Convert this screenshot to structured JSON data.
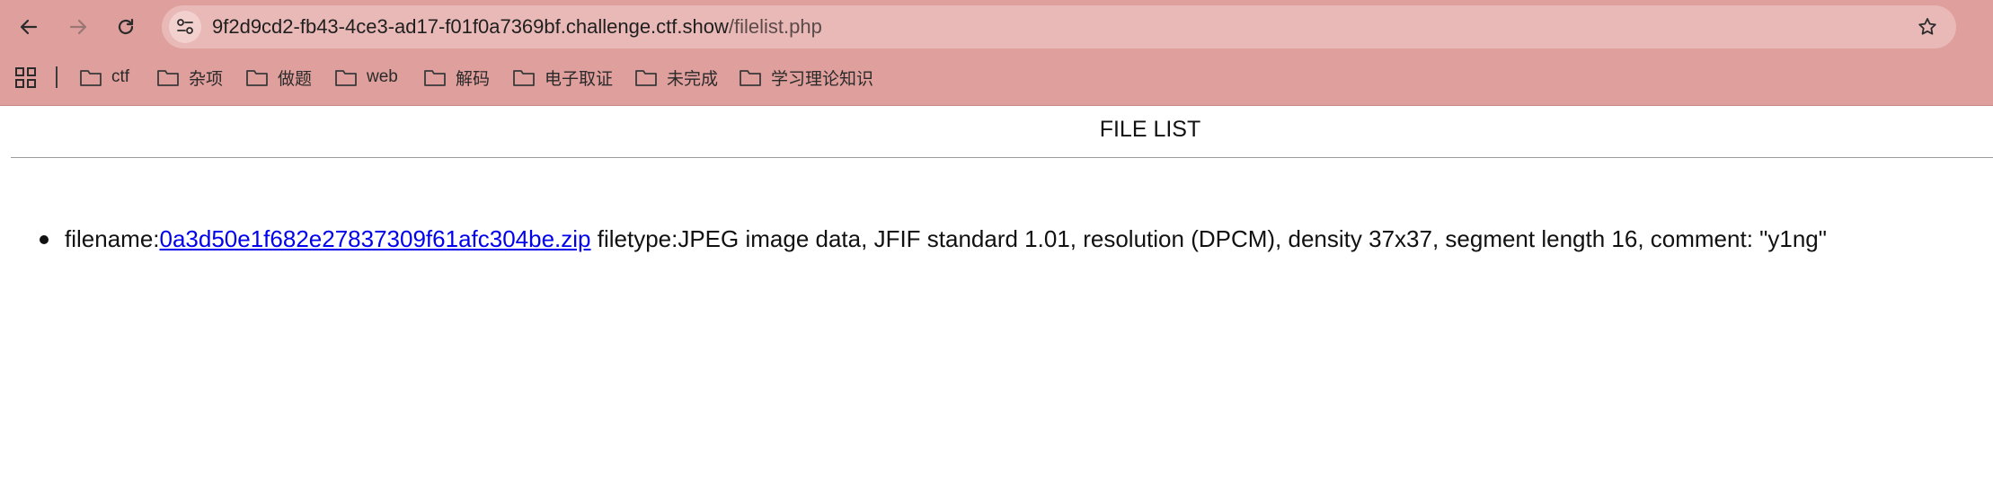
{
  "browser": {
    "url_host": "9f2d9cd2-fb43-4ce3-ad17-f01f0a7369bf.challenge.ctf.show",
    "url_path": "/filelist.php",
    "nav_icons": [
      "back-arrow-icon",
      "forward-arrow-icon",
      "reload-icon",
      "site-info-icon",
      "star-icon"
    ],
    "bookmarks": [
      {
        "label": "ctf"
      },
      {
        "label": "杂项"
      },
      {
        "label": "做题"
      },
      {
        "label": "web"
      },
      {
        "label": "解码"
      },
      {
        "label": "电子取证"
      },
      {
        "label": "未完成"
      },
      {
        "label": "学习理论知识"
      }
    ]
  },
  "colors": {
    "chrome_bg": "#df9f9c",
    "omnibox_bg": "#e9b9b7",
    "link": "#0000ee"
  },
  "page": {
    "title": "FILE LIST",
    "files": [
      {
        "filename_label": "filename:",
        "filename": "0a3d50e1f682e27837309f61afc304be.zip",
        "filetype_text": " filetype:JPEG image data, JFIF standard 1.01, resolution (DPCM), density 37x37, segment length 16, comment: \"y1ng\""
      }
    ]
  }
}
